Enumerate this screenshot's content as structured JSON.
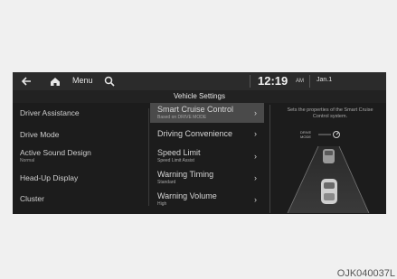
{
  "topbar": {
    "menu_label": "Menu",
    "time": "12:19",
    "ampm": "AM",
    "date": "Jan.1"
  },
  "page_title": "Vehicle Settings",
  "left_menu": {
    "items": [
      {
        "label": "Driver Assistance",
        "sub": ""
      },
      {
        "label": "Drive Mode",
        "sub": ""
      },
      {
        "label": "Active Sound Design",
        "sub": "Normal"
      },
      {
        "label": "Head-Up Display",
        "sub": ""
      },
      {
        "label": "Cluster",
        "sub": ""
      }
    ]
  },
  "mid_menu": {
    "items": [
      {
        "label": "Smart Cruise Control",
        "sub": "Based on DRIVE MODE",
        "selected": true
      },
      {
        "label": "Driving Convenience",
        "sub": ""
      },
      {
        "label": "Speed Limit",
        "sub": "Speed Limit Assist"
      },
      {
        "label": "Warning Timing",
        "sub": "Standard"
      },
      {
        "label": "Warning Volume",
        "sub": "High"
      }
    ],
    "chevron": "›"
  },
  "right_panel": {
    "description": "Sets the properties of the Smart Cruise Control system.",
    "drive_mode_label": "DRIVE\nMODE"
  },
  "caption": "OJK040037L"
}
